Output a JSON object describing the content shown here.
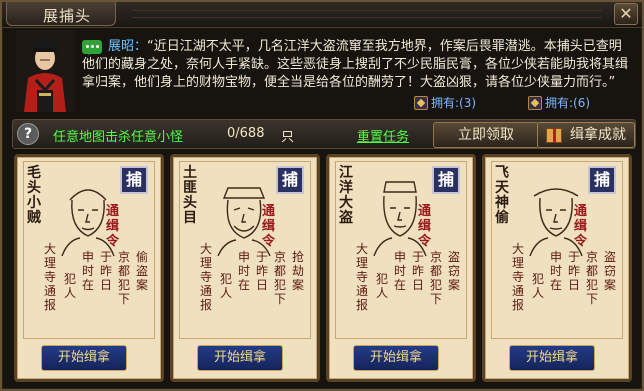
{
  "window": {
    "title": "展捕头",
    "close_label": "✕"
  },
  "dialog": {
    "speaker": "展昭：",
    "text": "“近日江湖不太平，几名江洋大盗流窜至我方地界，作案后畏罪潜逃。本捕头已查明他们的藏身之处，奈何人手紧缺。这些恶徒身上搜刮了不少民脂民膏，各位少侠若能助我将其缉拿归案，他们身上的财物宝物，便全当是给各位的酬劳了！大盗凶狠，请各位少侠量力而行。”"
  },
  "owned": [
    {
      "label": "拥有:(3)",
      "icon": "token-icon"
    },
    {
      "label": "拥有:(6)",
      "icon": "token-icon"
    }
  ],
  "task": {
    "help": "?",
    "desc": "任意地图击杀任意小怪",
    "progress": "0/688",
    "unit": "只",
    "reset": "重置任务",
    "receive": "立即领取",
    "success": "缉拿成就"
  },
  "cards": [
    {
      "name": "毛头小贼",
      "seal": "捕",
      "wanted": "通缉令",
      "cols": [
        "偷盗案",
        "京都犯下",
        "于昨日",
        "申时在",
        "犯人",
        "大理寺通报"
      ],
      "button": "开始缉拿"
    },
    {
      "name": "土匪头目",
      "seal": "捕",
      "wanted": "通缉令",
      "cols": [
        "抢劫案",
        "京都犯下",
        "于昨日",
        "申时在",
        "犯人",
        "大理寺通报"
      ],
      "button": "开始缉拿"
    },
    {
      "name": "江洋大盗",
      "seal": "捕",
      "wanted": "通缉令",
      "cols": [
        "盗窃案",
        "京都犯下",
        "于昨日",
        "申时在",
        "犯人",
        "大理寺通报"
      ],
      "button": "开始缉拿"
    },
    {
      "name": "飞天神偷",
      "seal": "捕",
      "wanted": "通缉令",
      "cols": [
        "盗窃案",
        "京都犯下",
        "于昨日",
        "申时在",
        "犯人",
        "大理寺通报"
      ],
      "button": "开始缉拿"
    }
  ]
}
